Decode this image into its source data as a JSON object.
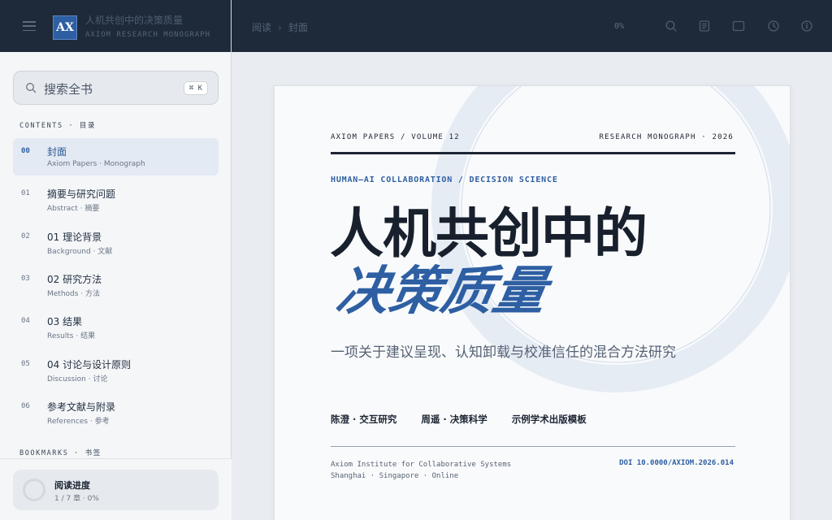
{
  "brand": {
    "title": "人机共创中的决策质量",
    "subtitle": "AXIOM RESEARCH MONOGRAPH",
    "logo": "AX"
  },
  "search": {
    "placeholder": "搜索全书",
    "shortcut": "⌘ K"
  },
  "sidebar": {
    "contents_label": "CONTENTS · 目录",
    "bookmarks_label": "BOOKMARKS · 书签",
    "items": [
      {
        "num": "00",
        "title": "封面",
        "sub": "Axiom Papers · Monograph",
        "active": true
      },
      {
        "num": "01",
        "title": "摘要与研究问题",
        "sub": "Abstract · 摘要"
      },
      {
        "num": "02",
        "title": "01 理论背景",
        "sub": "Background · 文献"
      },
      {
        "num": "03",
        "title": "02 研究方法",
        "sub": "Methods · 方法"
      },
      {
        "num": "04",
        "title": "03 结果",
        "sub": "Results · 结果"
      },
      {
        "num": "05",
        "title": "04 讨论与设计原则",
        "sub": "Discussion · 讨论"
      },
      {
        "num": "06",
        "title": "参考文献与附录",
        "sub": "References · 参考"
      }
    ],
    "progress": {
      "title": "阅读进度",
      "sub": "1 / 7 章 · 0%",
      "fraction": 0
    }
  },
  "topbar": {
    "crumb_root": "阅读",
    "crumb_sep": "›",
    "crumb_current": "封面",
    "progress_text": "0%",
    "icons": [
      "search-icon",
      "contents-icon",
      "layout-icon",
      "clock-icon",
      "info-icon"
    ]
  },
  "page": {
    "header_left": "AXIOM PAPERS / VOLUME 12",
    "header_right": "RESEARCH MONOGRAPH · 2026",
    "field": "HUMAN–AI COLLABORATION / DECISION SCIENCE",
    "title_line1": "人机共创中的",
    "title_line2": "决策质量",
    "subtitle": "一项关于建议呈现、认知卸载与校准信任的混合方法研究",
    "authors": [
      "陈澄 · 交互研究",
      "周遥 · 决策科学",
      "示例学术出版模板"
    ],
    "institution": "Axiom Institute for Collaborative Systems",
    "locations": "Shanghai · Singapore · Online",
    "doi": "DOI 10.0000/AXIOM.2026.014"
  },
  "colors": {
    "accent": "#2e5fa3",
    "topbar": "#1e2a3a",
    "ink": "#1c2533"
  }
}
